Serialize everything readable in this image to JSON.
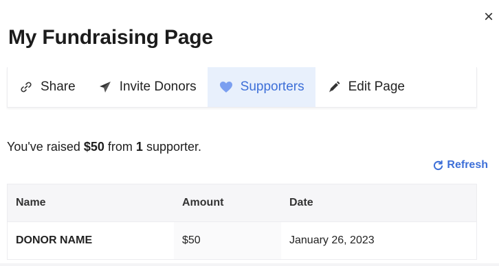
{
  "modal": {
    "title": "My Fundraising Page",
    "close_label": "×"
  },
  "tabs": [
    {
      "label": "Share",
      "icon": "link-icon",
      "active": false
    },
    {
      "label": "Invite Donors",
      "icon": "paper-plane-icon",
      "active": false
    },
    {
      "label": "Supporters",
      "icon": "heart-icon",
      "active": true
    },
    {
      "label": "Edit Page",
      "icon": "pencil-icon",
      "active": false
    }
  ],
  "summary": {
    "prefix": "You've raised ",
    "amount": "$50",
    "middle": " from ",
    "count": "1",
    "suffix": " supporter."
  },
  "refresh_label": "Refresh",
  "table": {
    "headers": [
      "Name",
      "Amount",
      "Date"
    ],
    "rows": [
      {
        "name": "DONOR NAME",
        "amount": "$50",
        "date": "January 26, 2023"
      }
    ]
  },
  "colors": {
    "accent": "#3d6fd8",
    "active_tab_bg": "#e8f0fc",
    "heart": "#7b9ff0"
  }
}
